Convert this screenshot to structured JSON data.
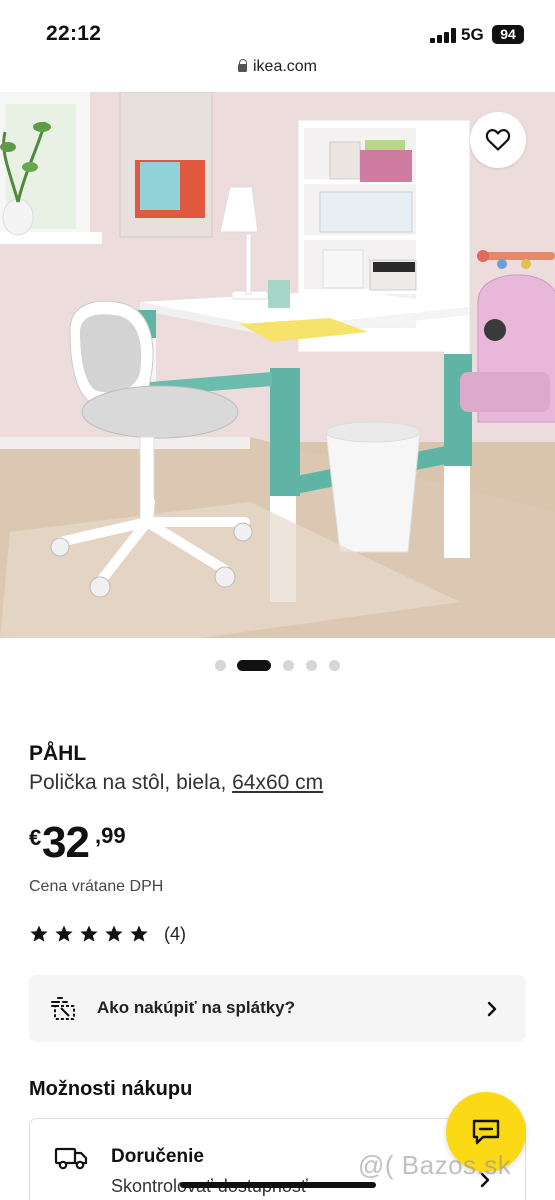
{
  "status_bar": {
    "time": "22:12",
    "network": "5G",
    "battery": "94"
  },
  "browser": {
    "url": "ikea.com"
  },
  "gallery": {
    "slide_count": 5,
    "active_slide": 2
  },
  "product": {
    "name": "PÅHL",
    "description": "Polička na stôl, biela, ",
    "size": "64x60 cm",
    "price": {
      "currency": "€",
      "whole": "32",
      "cents": ",99"
    },
    "vat_note": "Cena vrátane DPH",
    "rating": {
      "stars": 5,
      "count": "(4)"
    }
  },
  "installment": {
    "label": "Ako nakúpiť na splátky?"
  },
  "purchase_options": {
    "title": "Možnosti nákupu",
    "delivery": {
      "title": "Doručenie",
      "subtitle": "Skontrolovať dostupnosť"
    }
  },
  "watermark": "@( Bazos.sk",
  "colors": {
    "chat_yellow": "#fbd914",
    "text": "#111111",
    "installment_bg": "#f5f5f5",
    "desk_teal": "#5fb4a6",
    "wall_pink": "#ecdcdb"
  },
  "icons": [
    "lock-icon",
    "heart-icon",
    "star-icon",
    "installment-icon",
    "chevron-right-icon",
    "truck-icon",
    "chat-icon"
  ]
}
